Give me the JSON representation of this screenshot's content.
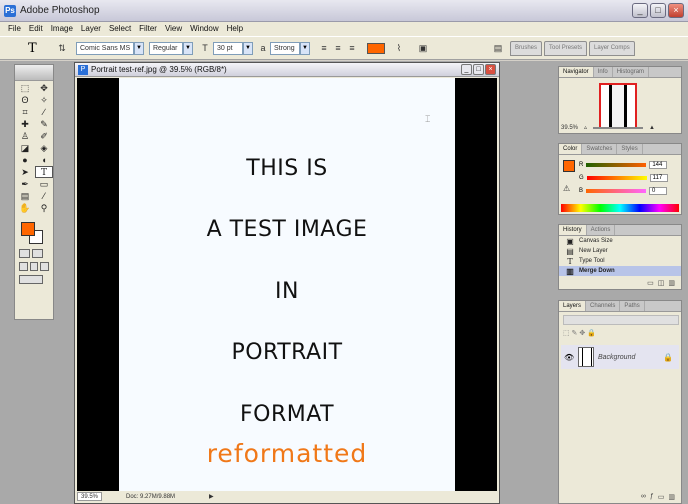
{
  "app": {
    "title": "Adobe Photoshop",
    "icon": "photoshop-icon"
  },
  "window_controls": [
    "_",
    "□",
    "×"
  ],
  "menu": [
    "File",
    "Edit",
    "Image",
    "Layer",
    "Select",
    "Filter",
    "View",
    "Window",
    "Help"
  ],
  "options_bar": {
    "tool_glyph": "T",
    "font_family": "Comic Sans MS",
    "font_style": "Regular",
    "font_size": "30 pt",
    "antialias": "Strong",
    "text_color": "#ff6600",
    "palette_well_tabs": [
      "Brushes",
      "Tool Presets",
      "Layer Comps"
    ]
  },
  "document": {
    "title": "Portrait test-ref.jpg @ 39.5% (RGB/8*)",
    "lines": [
      "THIS IS",
      "A TEST IMAGE",
      "IN",
      "PORTRAIT",
      "FORMAT"
    ],
    "accent_line": "reformatted",
    "accent_color": "#f07818",
    "status_zoom": "39.5%",
    "status_doc": "Doc: 9.27M/9.88M"
  },
  "navigator": {
    "tabs": [
      "Navigator",
      "Info",
      "Histogram"
    ],
    "zoom": "39.5%"
  },
  "color": {
    "tabs": [
      "Color",
      "Swatches",
      "Styles"
    ],
    "channels": [
      {
        "label": "R",
        "value": "144"
      },
      {
        "label": "G",
        "value": "117"
      },
      {
        "label": "B",
        "value": "0"
      }
    ]
  },
  "history": {
    "tabs": [
      "History",
      "Actions"
    ],
    "items": [
      "Canvas Size",
      "New Layer",
      "Type Tool",
      "Merge Down"
    ]
  },
  "layers": {
    "tabs": [
      "Layers",
      "Channels",
      "Paths"
    ],
    "items": [
      {
        "name": "Background"
      }
    ]
  }
}
